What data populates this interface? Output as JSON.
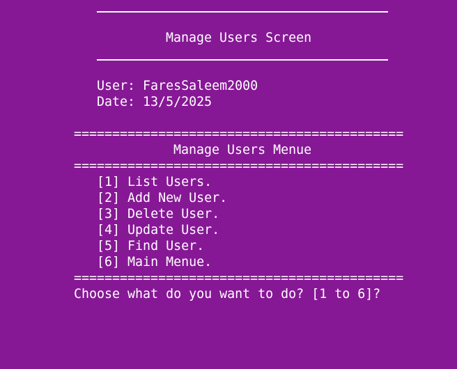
{
  "header": {
    "title": "Manage Users Screen"
  },
  "session": {
    "user_label": "User: ",
    "user_value": "FaresSaleem2000",
    "date_label": "Date: ",
    "date_value": "13/5/2025"
  },
  "menu": {
    "separator": "===========================================",
    "title": "Manage Users Menue",
    "items": [
      {
        "key": "[1]",
        "label": "List Users."
      },
      {
        "key": "[2]",
        "label": "Add New User."
      },
      {
        "key": "[3]",
        "label": "Delete User."
      },
      {
        "key": "[4]",
        "label": "Update User."
      },
      {
        "key": "[5]",
        "label": "Find User."
      },
      {
        "key": "[6]",
        "label": "Main Menue."
      }
    ]
  },
  "prompt": {
    "text": "Choose what do you want to do? [1 to 6]?"
  },
  "colors": {
    "background": "#861895",
    "foreground": "#ffffff"
  }
}
